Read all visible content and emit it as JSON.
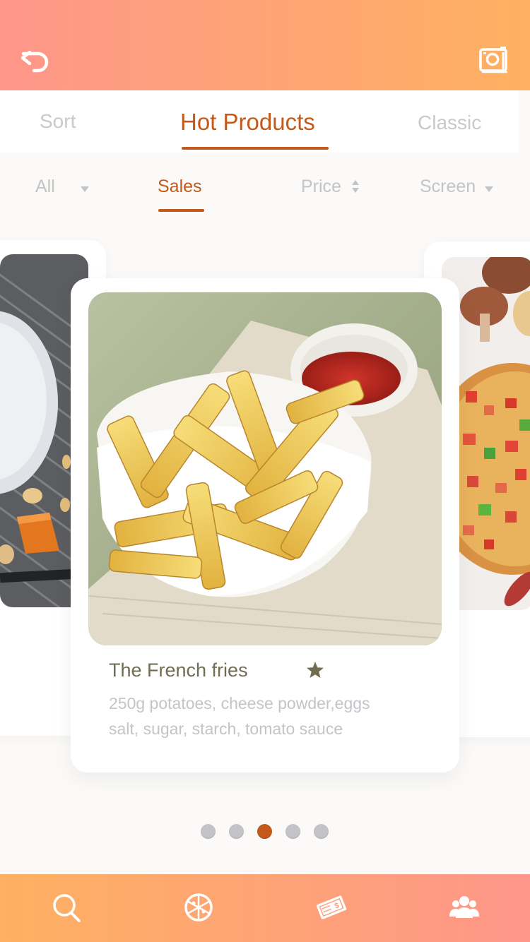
{
  "header": {
    "back_icon": "undo-arrow-icon",
    "camera_icon": "camera-icon"
  },
  "tabs": [
    {
      "label": "Sort",
      "active": false
    },
    {
      "label": "Hot Products",
      "active": true
    },
    {
      "label": "Classic",
      "active": false
    }
  ],
  "filters": [
    {
      "label": "All",
      "active": false,
      "icon": "caret-down-icon"
    },
    {
      "label": "Sales",
      "active": true
    },
    {
      "label": "Price",
      "active": false,
      "icon": "sort-updown-icon"
    },
    {
      "label": "Screen",
      "active": false,
      "icon": "caret-down-icon"
    }
  ],
  "carousel": {
    "current": {
      "name": "The French fries",
      "desc_lines": [
        "250g potatoes, cheese powder,eggs",
        "salt, sugar, starch, tomato sauce"
      ],
      "image": "french-fries-bowl-with-ketchup",
      "favorite_icon": "star-icon"
    },
    "left_image": "plate-with-garlic-and-pumpkin",
    "right_image": "pizza-with-mushrooms",
    "page_count": 5,
    "active_index": 2
  },
  "bottom_nav": [
    {
      "icon": "search-icon"
    },
    {
      "icon": "pizza-icon"
    },
    {
      "icon": "coupon-ticket-icon"
    },
    {
      "icon": "users-group-icon"
    }
  ],
  "colors": {
    "accent": "#c35a1c",
    "header_gradient_start": "#fe968a",
    "header_gradient_end": "#feb161",
    "inactive_text": "#c4c4c4",
    "dot_inactive": "#c4c4c8"
  }
}
